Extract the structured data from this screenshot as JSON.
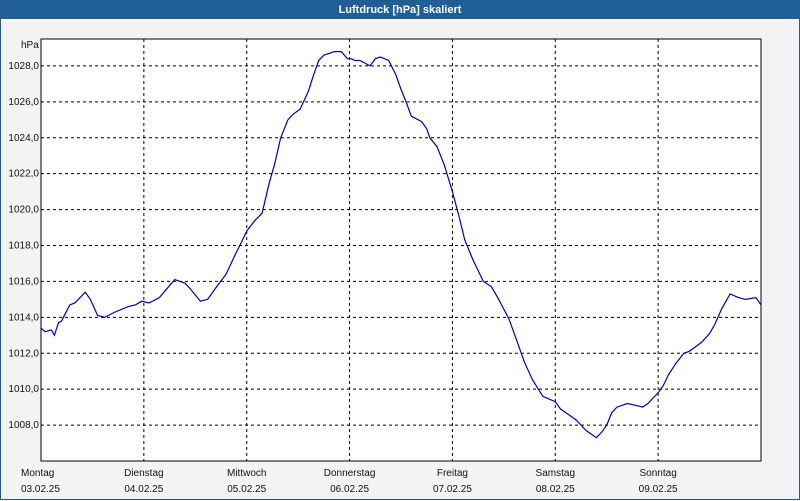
{
  "window": {
    "title": "Luftdruck [hPa] skaliert"
  },
  "chart_data": {
    "type": "line",
    "title": "Luftdruck [hPa] skaliert",
    "ylabel": "hPa",
    "ylim": [
      1006.0,
      1029.5
    ],
    "yticks": [
      "1008,0",
      "1010,0",
      "1012,0",
      "1014,0",
      "1016,0",
      "1018,0",
      "1020,0",
      "1022,0",
      "1024,0",
      "1026,0",
      "1028,0"
    ],
    "ytick_values": [
      1008,
      1010,
      1012,
      1014,
      1016,
      1018,
      1020,
      1022,
      1024,
      1026,
      1028
    ],
    "xlim": [
      0,
      7
    ],
    "xticks": [
      {
        "day": "Montag",
        "date": "03.02.25"
      },
      {
        "day": "Dienstag",
        "date": "04.02.25"
      },
      {
        "day": "Mittwoch",
        "date": "05.02.25"
      },
      {
        "day": "Donnerstag",
        "date": "06.02.25"
      },
      {
        "day": "Freitag",
        "date": "07.02.25"
      },
      {
        "day": "Samstag",
        "date": "08.02.25"
      },
      {
        "day": "Sonntag",
        "date": "09.02.25"
      }
    ],
    "grid": true,
    "line_color": "#0000aa",
    "series": [
      {
        "x": [
          0.0,
          0.04,
          0.1,
          0.13,
          0.17,
          0.2,
          0.28,
          0.33,
          0.43,
          0.48,
          0.55,
          0.62,
          0.72,
          0.85,
          0.92,
          0.98,
          1.05,
          1.15,
          1.3,
          1.4,
          1.45,
          1.55,
          1.62,
          1.72,
          1.8,
          1.88,
          1.95,
          2.0,
          2.08,
          2.15,
          2.22,
          2.27,
          2.33,
          2.4,
          2.45,
          2.52,
          2.6,
          2.65,
          2.7,
          2.75,
          2.8,
          2.85,
          2.92,
          2.98,
          3.02,
          3.05,
          3.1,
          3.2,
          3.25,
          3.3,
          3.38,
          3.45,
          3.5,
          3.55,
          3.6,
          3.7,
          3.75,
          3.78,
          3.85,
          3.92,
          4.0,
          4.07,
          4.12,
          4.2,
          4.3,
          4.38,
          4.45,
          4.55,
          4.62,
          4.7,
          4.78,
          4.88,
          5.0,
          5.05,
          5.1,
          5.15,
          5.2,
          5.25,
          5.3,
          5.4,
          5.45,
          5.5,
          5.55,
          5.6,
          5.7,
          5.78,
          5.85,
          5.9,
          5.95,
          6.0,
          6.05,
          6.1,
          6.18,
          6.25,
          6.3,
          6.35,
          6.42,
          6.5,
          6.55,
          6.62,
          6.7,
          6.78,
          6.85,
          6.95
        ],
        "y": [
          1013.4,
          1013.2,
          1013.3,
          1013.0,
          1013.7,
          1013.8,
          1014.7,
          1014.8,
          1015.4,
          1015.0,
          1014.1,
          1014.0,
          1014.3,
          1014.6,
          1014.7,
          1014.9,
          1014.8,
          1015.1,
          1016.1,
          1015.9,
          1015.6,
          1014.9,
          1015.0,
          1015.8,
          1016.4,
          1017.4,
          1018.2,
          1018.8,
          1019.4,
          1019.8,
          1021.5,
          1022.5,
          1024.0,
          1025.0,
          1025.3,
          1025.6,
          1026.6,
          1027.5,
          1028.3,
          1028.6,
          1028.7,
          1028.8,
          1028.8,
          1028.4,
          1028.4,
          1028.3,
          1028.3,
          1028.0,
          1028.4,
          1028.5,
          1028.3,
          1027.5,
          1026.7,
          1026.0,
          1025.2,
          1024.9,
          1024.5,
          1024.0,
          1023.5,
          1022.5,
          1021.0,
          1019.5,
          1018.3,
          1017.2,
          1016.0,
          1015.7,
          1015.0,
          1013.9,
          1012.8,
          1011.5,
          1010.5,
          1009.6,
          1009.3,
          1008.9,
          1008.7,
          1008.5,
          1008.3,
          1008.0,
          1007.7,
          1007.3,
          1007.6,
          1008.0,
          1008.7,
          1009.0,
          1009.2,
          1009.1,
          1009.0,
          1009.2,
          1009.5,
          1009.8,
          1010.2,
          1010.8,
          1011.5,
          1012.0,
          1012.1,
          1012.3,
          1012.6,
          1013.1,
          1013.6,
          1014.5,
          1015.3,
          1015.1,
          1015.0,
          1015.1
        ],
        "x_tail": [
          7.0
        ],
        "y_tail": [
          1014.7
        ]
      }
    ]
  }
}
